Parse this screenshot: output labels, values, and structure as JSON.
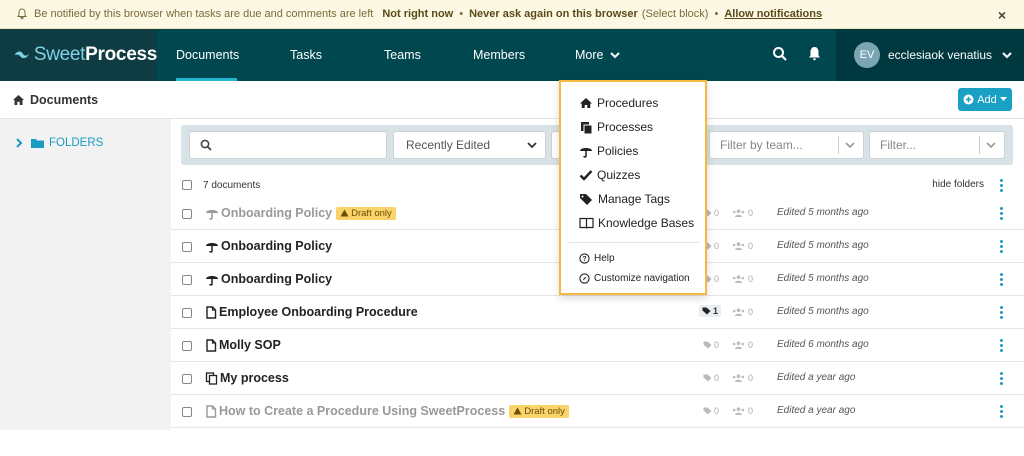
{
  "notification": {
    "message": "Be notified by this browser when tasks are due and comments are left",
    "not_now": "Not right now",
    "never": "Never ask again on this browser",
    "select_block": "(Select block)",
    "allow": "Allow notifications",
    "close": "×"
  },
  "nav": {
    "logo_light": "Sweet",
    "logo_bold": "Process",
    "items": [
      "Documents",
      "Tasks",
      "Teams",
      "Members",
      "More"
    ],
    "user_initials": "EV",
    "user_name": "ecclesiaok venatius"
  },
  "breadcrumb": {
    "label": "Documents"
  },
  "add_button": {
    "label": "Add"
  },
  "sidebar": {
    "folders_label": "FOLDERS"
  },
  "filters": {
    "search_placeholder": "",
    "sort_value": "Recently Edited",
    "team_placeholder": "Filter by team...",
    "filter_placeholder": "Filter..."
  },
  "list": {
    "count_label": "7 documents",
    "hide_folders": "hide folders",
    "rows": [
      {
        "icon": "policy",
        "title": "Onboarding Policy",
        "draft": true,
        "tags": "0",
        "members": "0",
        "edited": "Edited 5 months ago"
      },
      {
        "icon": "policy",
        "title": "Onboarding Policy",
        "draft": false,
        "tags": "0",
        "members": "0",
        "edited": "Edited 5 months ago"
      },
      {
        "icon": "policy",
        "title": "Onboarding Policy",
        "draft": false,
        "tags": "0",
        "members": "0",
        "edited": "Edited 5 months ago"
      },
      {
        "icon": "procedure",
        "title": "Employee Onboarding Procedure",
        "draft": false,
        "tags": "1",
        "members": "0",
        "edited": "Edited 5 months ago"
      },
      {
        "icon": "procedure",
        "title": "Molly SOP",
        "draft": false,
        "tags": "0",
        "members": "0",
        "edited": "Edited 6 months ago"
      },
      {
        "icon": "process",
        "title": "My process",
        "draft": false,
        "tags": "0",
        "members": "0",
        "edited": "Edited a year ago"
      },
      {
        "icon": "procedure",
        "title": "How to Create a Procedure Using SweetProcess",
        "draft": true,
        "tags": "0",
        "members": "0",
        "edited": "Edited a year ago"
      }
    ],
    "draft_label": "Draft only"
  },
  "more_menu": {
    "items": [
      "Procedures",
      "Processes",
      "Policies",
      "Quizzes",
      "Manage Tags",
      "Knowledge Bases"
    ],
    "help": "Help",
    "customize": "Customize navigation"
  },
  "colors": {
    "nav_bg": "#00474f",
    "accent": "#1a9cc0",
    "draft_badge": "#fad46b",
    "menu_highlight": "#f5b940"
  }
}
